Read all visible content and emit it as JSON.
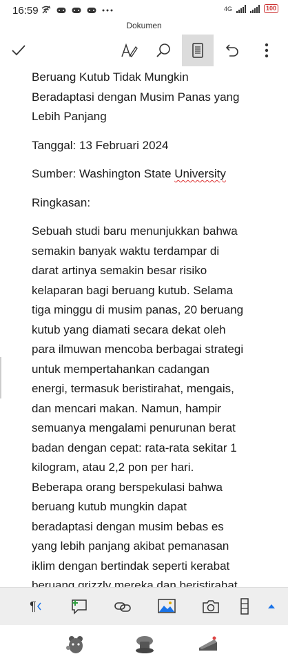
{
  "status": {
    "time": "16:59",
    "network": "4G",
    "battery": "100"
  },
  "header": {
    "title": "Dokumen"
  },
  "document": {
    "title_lines": [
      "Beruang Kutub Tidak Mungkin",
      "Beradaptasi dengan Musim Panas yang",
      "Lebih Panjang"
    ],
    "date_line": "Tanggal: 13 Februari 2024",
    "source_prefix": "Sumber: Washington State ",
    "source_word": "University",
    "summary_heading": "Ringkasan:",
    "body_lines": [
      "Sebuah studi baru menunjukkan bahwa",
      "semakin banyak waktu terdampar di",
      "darat artinya semakin besar risiko",
      "kelaparan bagi beruang kutub.  Selama",
      "tiga minggu di musim panas, 20 beruang",
      "kutub yang diamati secara dekat oleh",
      "para ilmuwan mencoba berbagai strategi",
      "untuk mempertahankan cadangan",
      "energi, termasuk beristirahat, mengais,",
      "dan mencari makan.  Namun, hampir",
      "semuanya mengalami penurunan berat",
      "badan dengan cepat: rata-rata sekitar 1",
      "kilogram, atau 2,2 pon per hari.",
      "Beberapa orang berspekulasi bahwa",
      "beruang kutub mungkin dapat",
      "beradaptasi dengan musim bebas es",
      "yang lebih panjang akibat pemanasan",
      "iklim dengan bertindak seperti kerabat",
      "beruang grizzly mereka dan beristirahat"
    ]
  },
  "bottom_toolbar": {
    "paragraph_glyph": "¶"
  }
}
